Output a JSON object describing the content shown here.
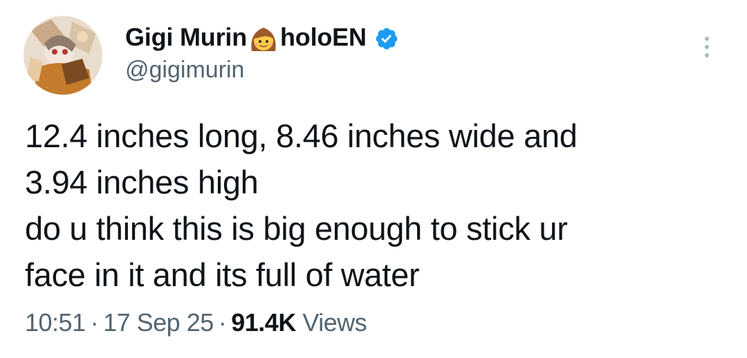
{
  "author": {
    "display_name": "Gigi Murin",
    "name_suffix": "holoEN",
    "name_emoji": "girl-emoji",
    "handle": "@gigimurin",
    "verified": true,
    "verified_color": "#1d9bf0"
  },
  "tweet": {
    "lines": [
      "12.4 inches long, 8.46 inches wide and",
      "3.94 inches high",
      "do u think this is big enough to stick ur",
      "face in it and its full of water"
    ]
  },
  "meta": {
    "time": "10:51",
    "separator": "·",
    "date": "17 Sep 25",
    "views_count": "91.4K",
    "views_label": "Views"
  },
  "icons": {
    "more": "more-options-icon",
    "verified": "verified-badge-icon"
  },
  "colors": {
    "text": "#0f1419",
    "secondary": "#536471",
    "accent": "#1d9bf0",
    "background": "#ffffff"
  }
}
